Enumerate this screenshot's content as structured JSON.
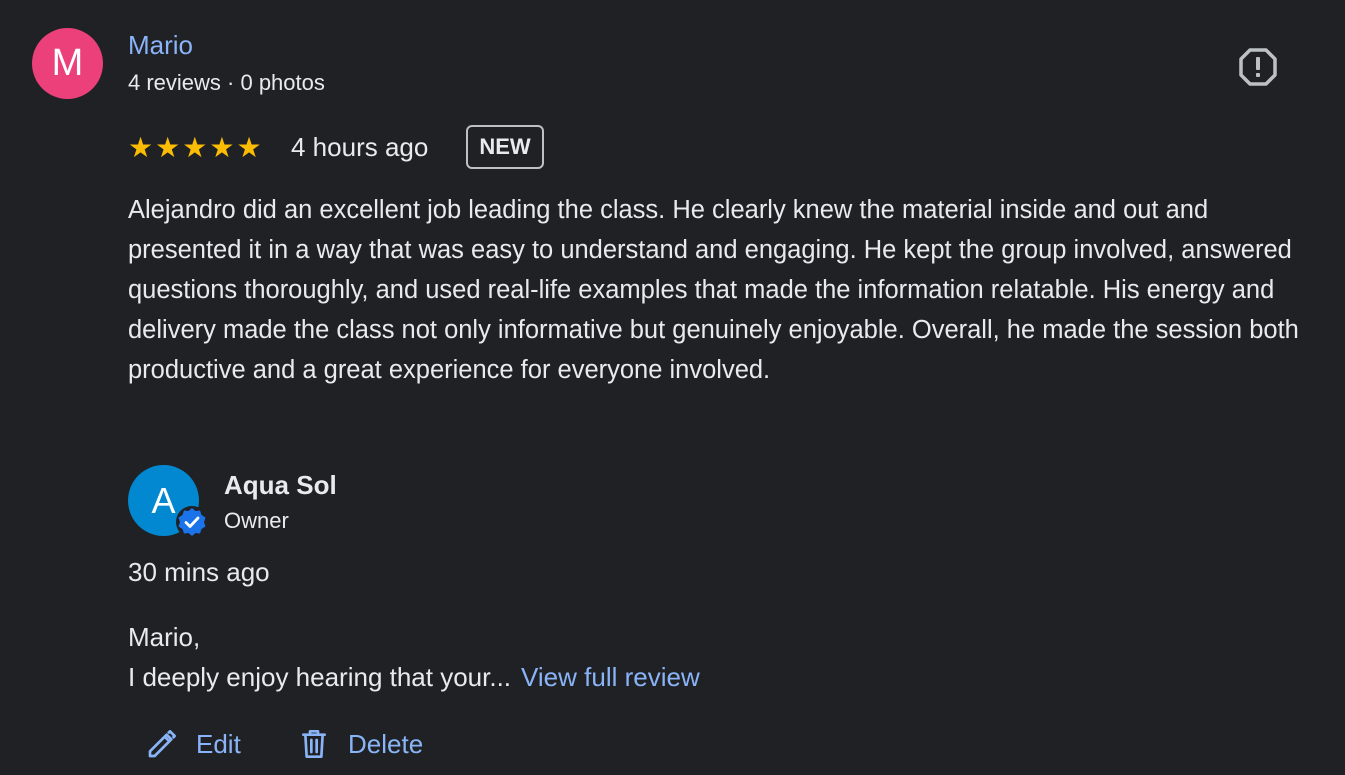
{
  "review": {
    "reviewer_initial": "M",
    "reviewer_name": "Mario",
    "reviewer_meta": "4 reviews · 0 photos",
    "rating_stars": 5,
    "time": "4 hours ago",
    "badge": "NEW",
    "text": "Alejandro did an excellent job leading the class. He clearly knew the material inside and out and presented it in a way that was easy to understand and engaging. He kept the group involved, answered questions thoroughly, and used real-life examples that made the information relatable. His energy and delivery made the class not only informative but genuinely enjoyable. Overall, he made the session both productive and a great experience for everyone involved."
  },
  "owner_reply": {
    "initial": "A",
    "name": "Aqua Sol",
    "role": "Owner",
    "time": "30 mins ago",
    "greeting": "Mario,",
    "snippet": "I deeply enjoy hearing that your...",
    "view_full_label": "View full review"
  },
  "actions": {
    "edit_label": "Edit",
    "delete_label": "Delete"
  },
  "colors": {
    "background": "#202124",
    "link": "#8ab4f8",
    "star": "#fbbc04",
    "reviewer_avatar": "#ec407a",
    "owner_avatar": "#0288d1"
  },
  "icons": [
    "report-flag-icon",
    "star-icon",
    "verified-badge-icon",
    "pencil-icon",
    "trash-icon"
  ]
}
